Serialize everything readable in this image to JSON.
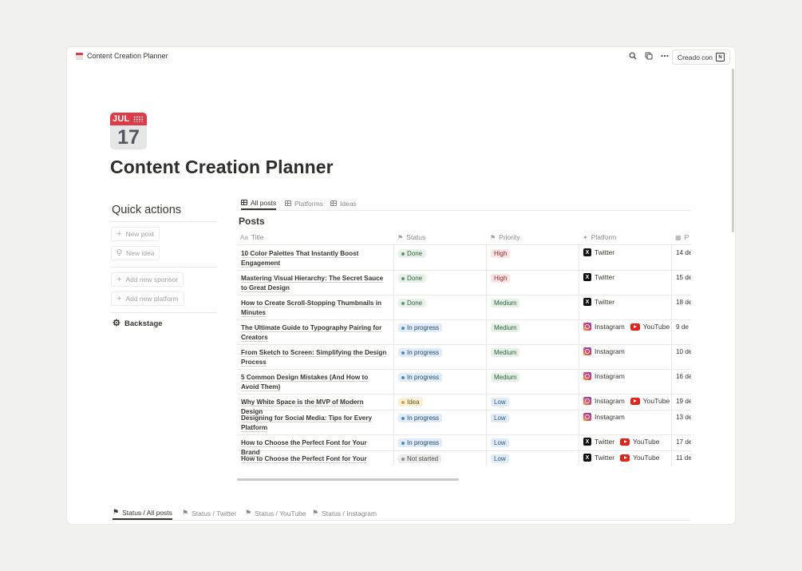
{
  "window": {
    "breadcrumb": "Content Creation Planner",
    "made_with": "Creado con"
  },
  "page": {
    "icon_month": "JUL",
    "icon_day": "17",
    "title": "Content Creation Planner"
  },
  "quick_actions": {
    "title": "Quick actions",
    "new_post": "New post",
    "new_idea": "New idea",
    "add_sponsor": "Add new sponsor",
    "add_platform": "Add new platform",
    "backstage": "Backstage"
  },
  "views": [
    "All posts",
    "Platforms",
    "Ideas"
  ],
  "database": {
    "title": "Posts",
    "columns": {
      "title": "Title",
      "status": "Status",
      "priority": "Priority",
      "platform": "Platform",
      "date": "P"
    },
    "rows": [
      {
        "title": "10 Color Palettes That Instantly Boost Engagement",
        "status": "Done",
        "priority": "High",
        "platforms": [
          "Twitter"
        ],
        "date": "14 de"
      },
      {
        "title": "Mastering Visual Hierarchy: The Secret Sauce to Great Design",
        "status": "Done",
        "priority": "High",
        "platforms": [
          "Twitter"
        ],
        "date": "15 de"
      },
      {
        "title": "How to Create Scroll-Stopping Thumbnails in Minutes",
        "status": "Done",
        "priority": "Medium",
        "platforms": [
          "Twitter"
        ],
        "date": "18 de"
      },
      {
        "title": "The Ultimate Guide to Typography Pairing for Creators",
        "status": "In progress",
        "priority": "Medium",
        "platforms": [
          "Instagram",
          "YouTube"
        ],
        "date": "9 de"
      },
      {
        "title": "From Sketch to Screen: Simplifying the Design Process",
        "status": "In progress",
        "priority": "Medium",
        "platforms": [
          "Instagram"
        ],
        "date": "10 de"
      },
      {
        "title": "5 Common Design Mistakes (And How to Avoid Them)",
        "status": "In progress",
        "priority": "Medium",
        "platforms": [
          "Instagram"
        ],
        "date": "16 de"
      },
      {
        "title": "Why White Space is the MVP of Modern Design",
        "status": "Idea",
        "priority": "Low",
        "platforms": [
          "Instagram",
          "YouTube"
        ],
        "date": "19 de"
      },
      {
        "title": "Designing for Social Media: Tips for Every Platform",
        "status": "In progress",
        "priority": "Low",
        "platforms": [
          "Instagram"
        ],
        "date": "13 de"
      },
      {
        "title": "How to Choose the Perfect Font for Your Brand",
        "status": "In progress",
        "priority": "Low",
        "platforms": [
          "Twitter",
          "YouTube"
        ],
        "date": "17 de"
      },
      {
        "title": "How to Choose the Perfect Font for Your Brand",
        "status": "Not started",
        "priority": "Low",
        "platforms": [
          "Twitter",
          "YouTube"
        ],
        "date": "11 de"
      }
    ]
  },
  "bottom_tabs": [
    "Status / All posts",
    "Status / Twitter",
    "Status / YouTube",
    "Status / Instagram"
  ]
}
